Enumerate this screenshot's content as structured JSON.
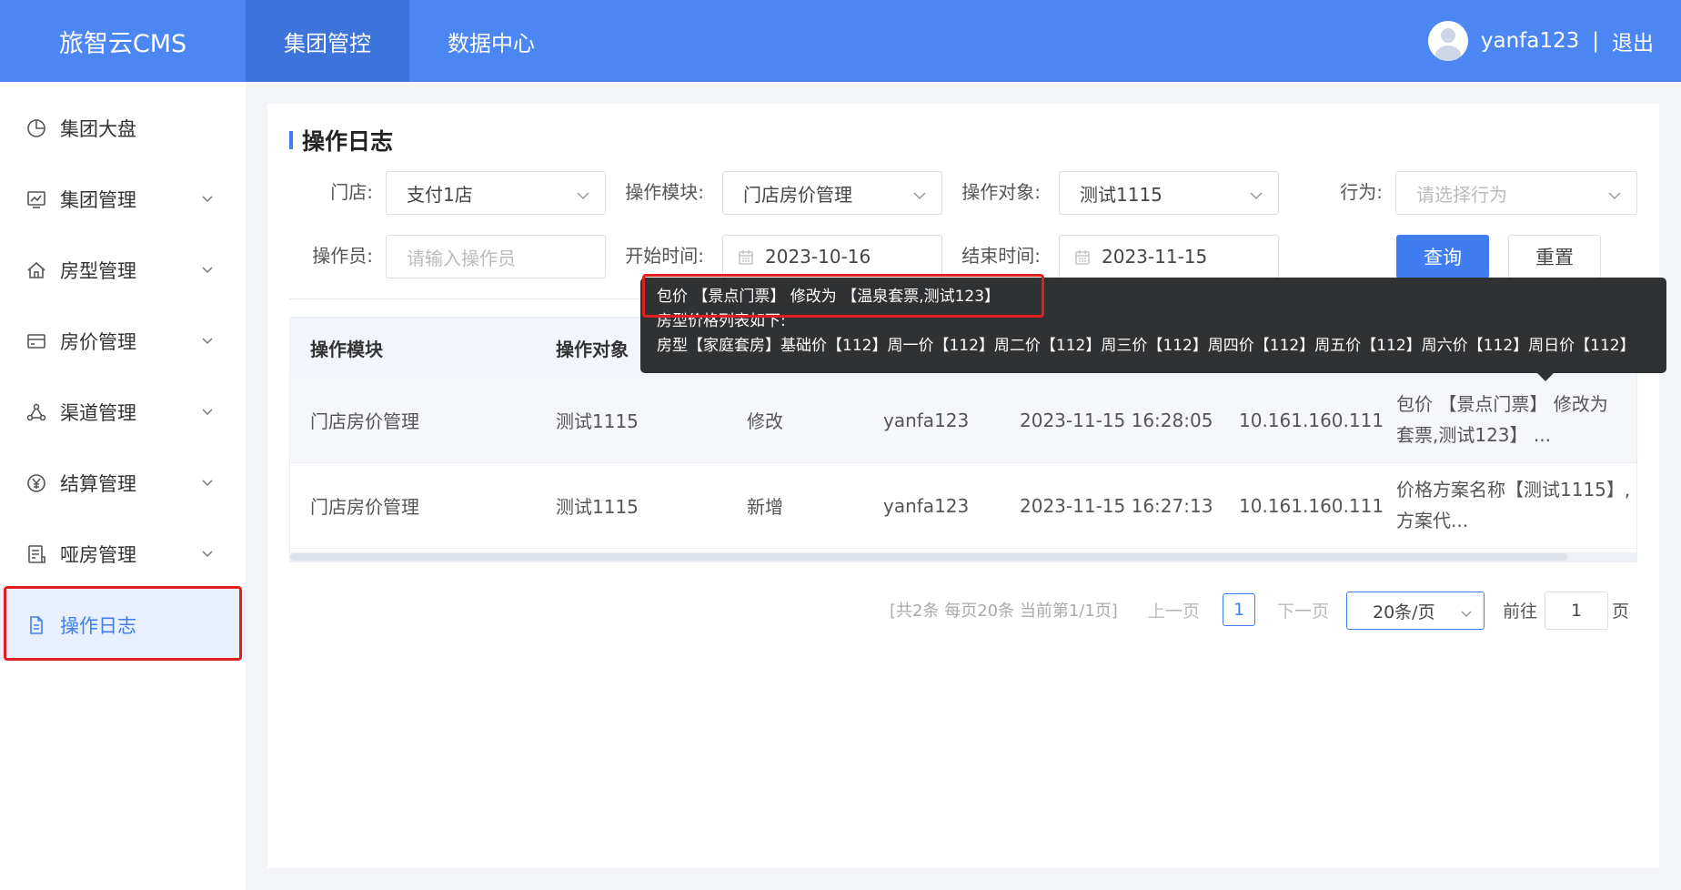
{
  "header": {
    "brand": "旅智云CMS",
    "nav": [
      {
        "label": "集团管控",
        "active": true
      },
      {
        "label": "数据中心",
        "active": false
      }
    ],
    "username": "yanfa123",
    "separator": "|",
    "logout": "退出"
  },
  "sidebar": {
    "items": [
      {
        "label": "集团大盘",
        "icon": "pie-chart-icon",
        "expandable": false
      },
      {
        "label": "集团管理",
        "icon": "monitor-chart-icon",
        "expandable": true
      },
      {
        "label": "房型管理",
        "icon": "home-icon",
        "expandable": true
      },
      {
        "label": "房价管理",
        "icon": "card-icon",
        "expandable": true
      },
      {
        "label": "渠道管理",
        "icon": "network-icon",
        "expandable": true
      },
      {
        "label": "结算管理",
        "icon": "yen-icon",
        "expandable": true
      },
      {
        "label": "哑房管理",
        "icon": "document-list-icon",
        "expandable": true
      },
      {
        "label": "操作日志",
        "icon": "document-icon",
        "expandable": false,
        "active": true
      }
    ]
  },
  "page": {
    "title": "操作日志"
  },
  "filters": {
    "store": {
      "label": "门店:",
      "value": "支付1店"
    },
    "module": {
      "label": "操作模块:",
      "value": "门店房价管理"
    },
    "target": {
      "label": "操作对象:",
      "value": "测试1115"
    },
    "action": {
      "label": "行为:",
      "placeholder": "请选择行为"
    },
    "operator": {
      "label": "操作员:",
      "placeholder": "请输入操作员"
    },
    "start": {
      "label": "开始时间:",
      "value": "2023-10-16"
    },
    "end": {
      "label": "结束时间:",
      "value": "2023-11-15"
    },
    "query_button": "查询",
    "reset_button": "重置"
  },
  "table": {
    "headers": [
      "操作模块",
      "操作对象"
    ],
    "rows": [
      {
        "module": "门店房价管理",
        "target": "测试1115",
        "action": "修改",
        "operator": "yanfa123",
        "time": "2023-11-15 16:28:05",
        "ip": "10.161.160.111",
        "desc_line1": "包价 【景点门票】 修改为",
        "desc_line2": "套票,测试123】 ..."
      },
      {
        "module": "门店房价管理",
        "target": "测试1115",
        "action": "新增",
        "operator": "yanfa123",
        "time": "2023-11-15 16:27:13",
        "ip": "10.161.160.111",
        "desc_line1": "价格方案名称【测试1115】,",
        "desc_line2": "方案代..."
      }
    ]
  },
  "pagination": {
    "info": "[共2条 每页20条 当前第1/1页]",
    "prev": "上一页",
    "current": "1",
    "next": "下一页",
    "page_size": "20条/页",
    "goto_label": "前往",
    "goto_value": "1",
    "goto_suffix": "页"
  },
  "tooltip": {
    "line1": "包价 【景点门票】 修改为 【温泉套票,测试123】",
    "line2": "房型价格列表如下:",
    "line3": "房型【家庭套房】基础价【112】周一价【112】周二价【112】周三价【112】周四价【112】周五价【112】周六价【112】周日价【112】"
  },
  "colors": {
    "primary": "#3f7df0",
    "header": "#4c86f3",
    "highlight": "#e02020"
  }
}
